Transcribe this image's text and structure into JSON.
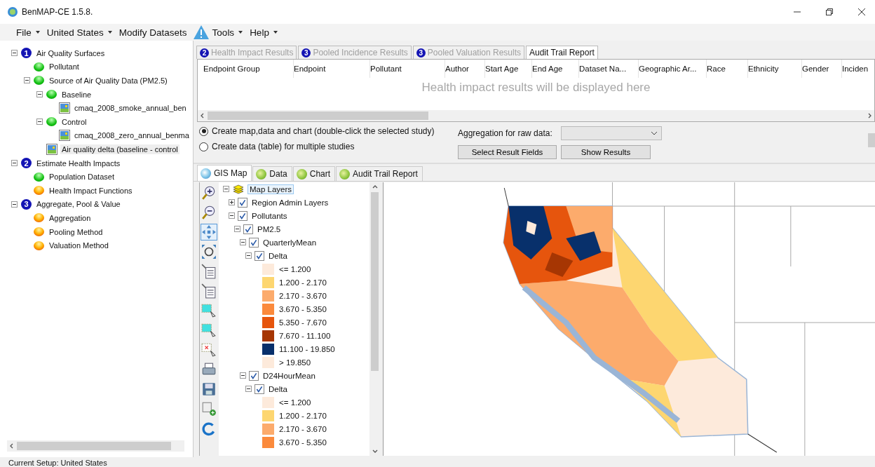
{
  "window": {
    "title": "BenMAP-CE 1.5.8."
  },
  "menu": [
    {
      "label": "File",
      "dropdown": true
    },
    {
      "label": "United States",
      "dropdown": true
    },
    {
      "label": "Modify Datasets",
      "dropdown": false
    },
    {
      "label": "Tools",
      "dropdown": true
    },
    {
      "label": "Help",
      "dropdown": true
    }
  ],
  "tree": [
    {
      "kind": "step",
      "number": "1",
      "label": "Air Quality Surfaces",
      "selected": false,
      "expanded": true,
      "children": [
        {
          "kind": "done",
          "label": "Pollutant",
          "selected": false
        },
        {
          "kind": "done",
          "label": "Source of Air Quality Data (PM2.5)",
          "selected": false,
          "expanded": true,
          "children": [
            {
              "kind": "done",
              "label": "Baseline",
              "selected": false,
              "expanded": true,
              "children": [
                {
                  "kind": "file",
                  "label": "cmaq_2008_smoke_annual_ben",
                  "selected": false
                }
              ]
            },
            {
              "kind": "done",
              "label": "Control",
              "selected": false,
              "expanded": true,
              "children": [
                {
                  "kind": "file",
                  "label": "cmaq_2008_zero_annual_benma",
                  "selected": false
                }
              ]
            },
            {
              "kind": "file",
              "label": "Air quality delta (baseline - control",
              "selected": true
            }
          ]
        }
      ]
    },
    {
      "kind": "step",
      "number": "2",
      "label": "Estimate Health Impacts",
      "selected": false,
      "expanded": true,
      "children": [
        {
          "kind": "done",
          "label": "Population Dataset",
          "selected": false
        },
        {
          "kind": "pending",
          "label": "Health Impact Functions",
          "selected": false
        }
      ]
    },
    {
      "kind": "step",
      "number": "3",
      "label": "Aggregate, Pool & Value",
      "selected": false,
      "expanded": true,
      "children": [
        {
          "kind": "pending",
          "label": "Aggregation",
          "selected": false
        },
        {
          "kind": "pending",
          "label": "Pooling Method",
          "selected": false
        },
        {
          "kind": "pending",
          "label": "Valuation Method",
          "selected": false
        }
      ]
    }
  ],
  "results_tabs": [
    {
      "number": "2",
      "label": "Health Impact Results",
      "selected": false,
      "disabled": true
    },
    {
      "number": "3",
      "label": "Pooled Incidence Results",
      "selected": false,
      "disabled": true
    },
    {
      "number": "3",
      "label": "Pooled Valuation Results",
      "selected": false,
      "disabled": true
    },
    {
      "label": "Audit Trail Report",
      "selected": true,
      "disabled": false
    }
  ],
  "results_table": {
    "columns": [
      "Endpoint Group",
      "Endpoint",
      "Pollutant",
      "Author",
      "Start Age",
      "End Age",
      "Dataset Na...",
      "Geographic Ar...",
      "Race",
      "Ethnicity",
      "Gender",
      "Inciden"
    ],
    "placeholder": "Health impact results will be displayed here"
  },
  "output_options": [
    {
      "label": "Create map,data and chart (double-click the selected study)",
      "selected": true
    },
    {
      "label": "Create data (table) for multiple studies",
      "selected": false
    }
  ],
  "aggregation": {
    "label": "Aggregation for raw data:"
  },
  "buttons": [
    "Select Result Fields",
    "Show Results"
  ],
  "view_tabs": [
    {
      "label": "GIS Map",
      "selected": true
    },
    {
      "label": "Data",
      "selected": false
    },
    {
      "label": "Chart",
      "selected": false
    },
    {
      "label": "Audit Trail Report",
      "selected": false
    }
  ],
  "layers": [
    {
      "kind": "root",
      "label": "Map Layers",
      "selected": true,
      "expanded": true,
      "children": [
        {
          "kind": "layer",
          "label": "Region Admin Layers",
          "checked": true,
          "expanded": false
        },
        {
          "kind": "layer",
          "label": "Pollutants",
          "checked": true,
          "expanded": true,
          "children": [
            {
              "kind": "layer",
              "label": "PM2.5",
              "checked": true,
              "expanded": true,
              "children": [
                {
                  "kind": "layer",
                  "label": "QuarterlyMean",
                  "checked": true,
                  "expanded": true,
                  "children": [
                    {
                      "kind": "layer",
                      "label": "Delta",
                      "checked": true,
                      "expanded": true,
                      "children": [
                        {
                          "kind": "legend",
                          "label": "<= 1.200",
                          "color": "#fdeadb"
                        },
                        {
                          "kind": "legend",
                          "label": "1.200 - 2.170",
                          "color": "#fdd670"
                        },
                        {
                          "kind": "legend",
                          "label": "2.170 - 3.670",
                          "color": "#fcab6c"
                        },
                        {
                          "kind": "legend",
                          "label": "3.670 - 5.350",
                          "color": "#fb8a3c"
                        },
                        {
                          "kind": "legend",
                          "label": "5.350 - 7.670",
                          "color": "#e6550d"
                        },
                        {
                          "kind": "legend",
                          "label": "7.670 - 11.100",
                          "color": "#a63603"
                        },
                        {
                          "kind": "legend",
                          "label": "11.100 - 19.850",
                          "color": "#08306b"
                        },
                        {
                          "kind": "legend",
                          "label": "> 19.850",
                          "color": "#fdeadb"
                        }
                      ]
                    }
                  ]
                },
                {
                  "kind": "layer",
                  "label": "D24HourMean",
                  "checked": true,
                  "expanded": true,
                  "children": [
                    {
                      "kind": "layer",
                      "label": "Delta",
                      "checked": true,
                      "expanded": true,
                      "children": [
                        {
                          "kind": "legend",
                          "label": "<= 1.200",
                          "color": "#fdeadb"
                        },
                        {
                          "kind": "legend",
                          "label": "1.200 - 2.170",
                          "color": "#fdd670"
                        },
                        {
                          "kind": "legend",
                          "label": "2.170 - 3.670",
                          "color": "#fcab6c"
                        },
                        {
                          "kind": "legend",
                          "label": "3.670 - 5.350",
                          "color": "#fb8a3c"
                        }
                      ]
                    }
                  ]
                }
              ]
            }
          ]
        }
      ]
    }
  ],
  "status_bar": {
    "text": "Current Setup: United States"
  }
}
